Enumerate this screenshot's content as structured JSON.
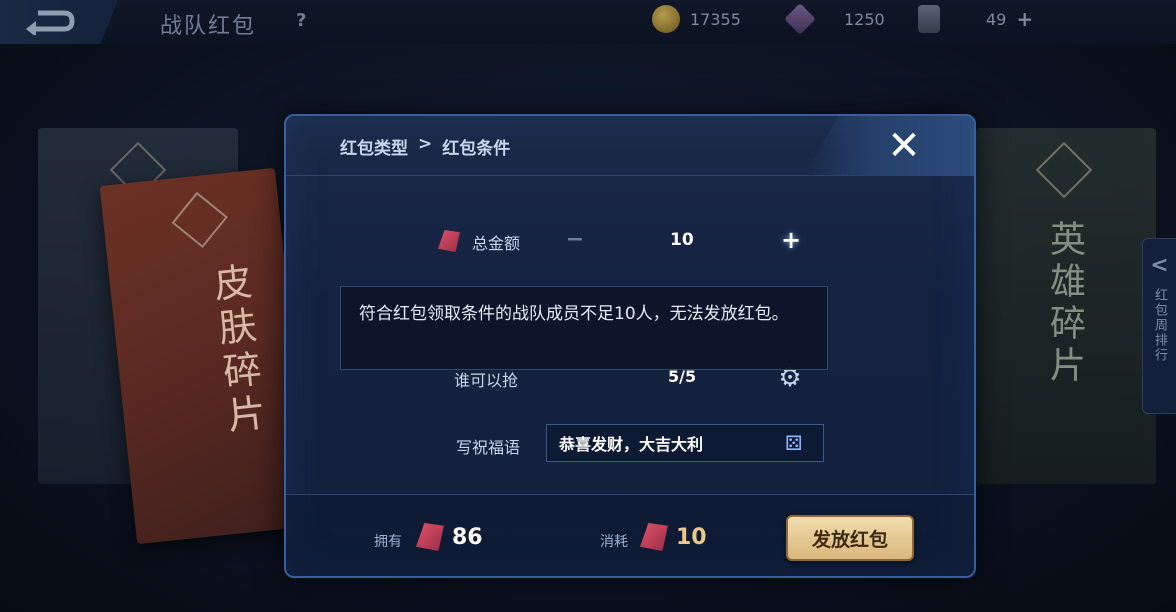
{
  "top_bar": {
    "title": "战队红包",
    "help": "?",
    "coins": "17355",
    "gems": "1250",
    "tickets": "49",
    "plus": "+"
  },
  "background": {
    "left_card_text": "皮肤碎片",
    "right_card_text": "英雄碎片",
    "side_tab_arrow": "<",
    "side_tab_label": "红包周排行"
  },
  "modal": {
    "breadcrumb": {
      "parent": "红包类型",
      "separator": ">",
      "current": "红包条件"
    },
    "close": "✕",
    "total_amount": {
      "label": "总金额",
      "minus": "−",
      "value": "10",
      "plus": "+"
    },
    "toast": "符合红包领取条件的战队成员不足10人，无法发放红包。",
    "who_can_grab": {
      "label": "谁可以抢",
      "value": "5/5"
    },
    "blessing": {
      "label": "写祝福语",
      "value": "恭喜发财，大吉大利"
    },
    "footer": {
      "owned_label": "拥有",
      "owned_value": "86",
      "cost_label": "消耗",
      "cost_value": "10",
      "send_button": "发放红包"
    }
  },
  "colors": {
    "modal_border": "#3a5f9c",
    "send_button": "#e8c98b",
    "cost_value": "#e8c98b"
  }
}
